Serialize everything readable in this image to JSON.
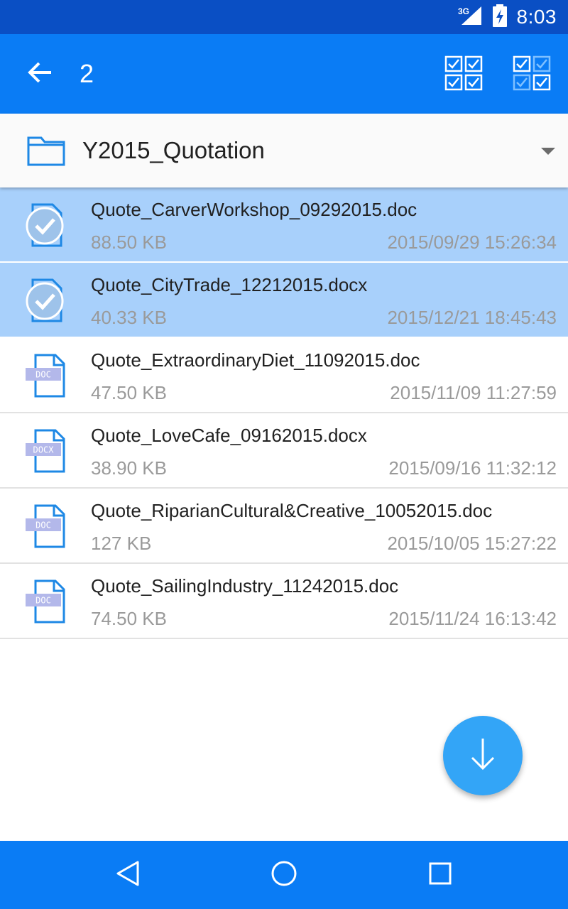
{
  "status_bar": {
    "network": "3G",
    "time": "8:03"
  },
  "app_bar": {
    "selected_count": "2",
    "actions": [
      {
        "icon": "select-all-icon"
      },
      {
        "icon": "invert-selection-icon"
      }
    ]
  },
  "folder": {
    "name": "Y2015_Quotation"
  },
  "files": [
    {
      "name": "Quote_CarverWorkshop_09292015.doc",
      "size": "88.50 KB",
      "date": "2015/09/29 15:26:34",
      "type": "DOC",
      "selected": true
    },
    {
      "name": "Quote_CityTrade_12212015.docx",
      "size": "40.33 KB",
      "date": "2015/12/21 18:45:43",
      "type": "DOCX",
      "selected": true
    },
    {
      "name": "Quote_ExtraordinaryDiet_11092015.doc",
      "size": "47.50 KB",
      "date": "2015/11/09 11:27:59",
      "type": "DOC",
      "selected": false
    },
    {
      "name": "Quote_LoveCafe_09162015.docx",
      "size": "38.90 KB",
      "date": "2015/09/16 11:32:12",
      "type": "DOCX",
      "selected": false
    },
    {
      "name": "Quote_RiparianCultural&Creative_10052015.doc",
      "size": "127 KB",
      "date": "2015/10/05 15:27:22",
      "type": "DOC",
      "selected": false
    },
    {
      "name": "Quote_SailingIndustry_11242015.doc",
      "size": "74.50 KB",
      "date": "2015/11/24 16:13:42",
      "type": "DOC",
      "selected": false
    }
  ],
  "fab": {
    "icon": "download-arrow-icon"
  },
  "colors": {
    "status_bar": "#0a4fc4",
    "primary": "#0a7cf5",
    "selected_row": "#a8d0fb",
    "fab": "#33a5f7",
    "doc_icon": "#1e88e5",
    "doc_badge": "#b3b8ea"
  }
}
